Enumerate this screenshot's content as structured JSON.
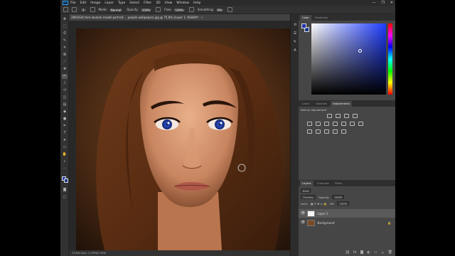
{
  "menubar": {
    "logo": "Ps",
    "items": [
      "File",
      "Edit",
      "Image",
      "Layer",
      "Type",
      "Select",
      "Filter",
      "3D",
      "View",
      "Window",
      "Help"
    ],
    "window_controls": [
      "—",
      "❐",
      "✕"
    ]
  },
  "options_bar": {
    "mode_label": "Mode:",
    "mode_value": "Normal",
    "opacity_label": "Opacity:",
    "opacity_value": "100%",
    "flow_label": "Flow:",
    "flow_value": "100%",
    "smoothing_label": "Smoothing:",
    "smoothing_value": "0%",
    "brush_size": "5"
  },
  "document": {
    "tab_title": "2861634 face women model portrait ... people wallpapers.jpg @ 75.8% (Layer 1, RGB/8*)",
    "close_glyph": "×",
    "status": "75.8%    Doc: 2.47M/2.47M"
  },
  "panels": {
    "color_tabs": [
      "Color",
      "Swatches"
    ],
    "mid_tabs": [
      "Learn",
      "Libraries",
      "Adjustments"
    ],
    "adj_title": "Add an adjustment",
    "layer_tabs": [
      "Layers",
      "Channels",
      "Paths"
    ],
    "kind_label": "Kind",
    "blend_mode": "Overlay",
    "opacity_label": "Opacity:",
    "opacity_value": "100%",
    "lock_label": "Lock:",
    "fill_label": "Fill:",
    "fill_value": "100%",
    "layers": [
      {
        "name": "Layer 1"
      },
      {
        "name": "Background"
      }
    ]
  },
  "colors": {
    "accent": "#31a8ff",
    "foreground": "#2233aa",
    "background": "#1a3a88"
  }
}
